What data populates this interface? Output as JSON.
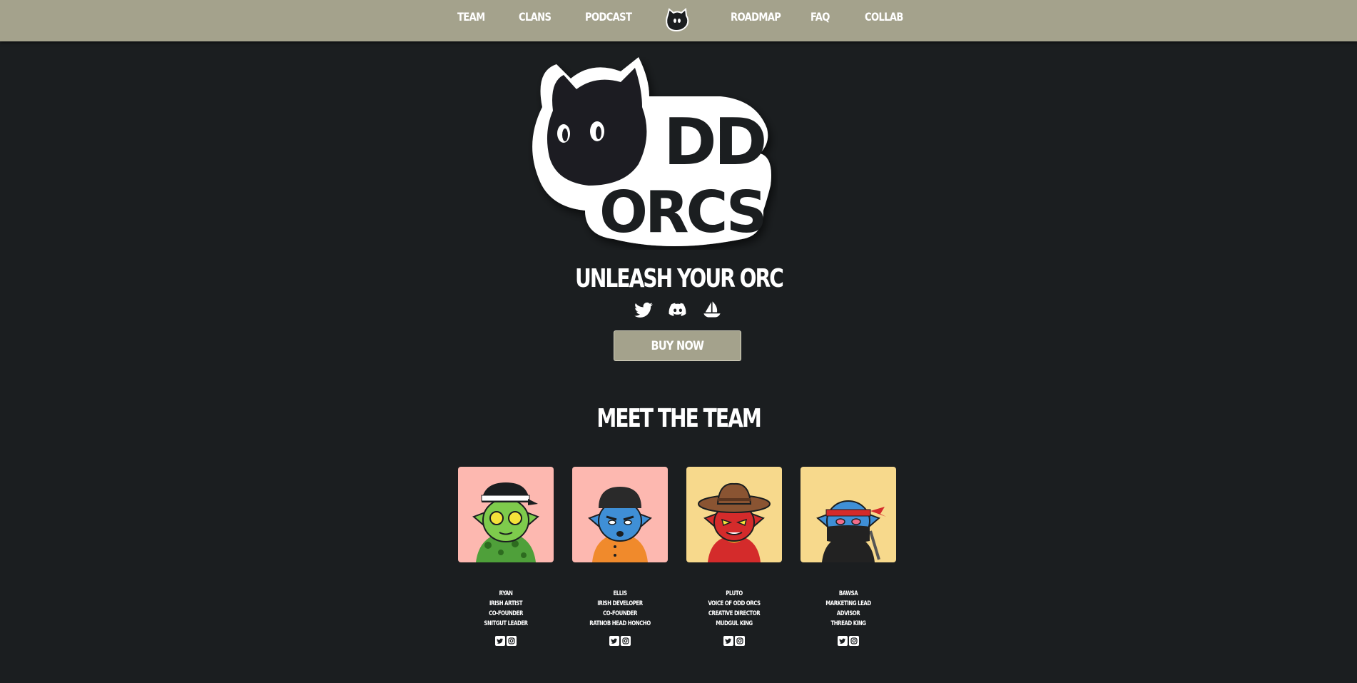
{
  "nav": {
    "left": [
      "TEAM",
      "CLANS",
      "PODCAST"
    ],
    "right": [
      "ROADMAP",
      "FAQ",
      "COLLAB"
    ],
    "logo_icon": "orc-head-icon"
  },
  "hero": {
    "logo_text_top": "DD",
    "logo_text_bottom": "ORCS",
    "tagline": "UNLEASH YOUR ORC",
    "social_icons": [
      "twitter-icon",
      "discord-icon",
      "opensea-icon"
    ],
    "buy_label": "BUY NOW"
  },
  "team": {
    "heading": "MEET THE TEAM",
    "members": [
      {
        "lines": [
          "RYAN",
          "IRISH ARTIST",
          "CO-FOUNDER",
          "SNITGUT LEADER"
        ],
        "bg": "#fdb8b0"
      },
      {
        "lines": [
          "ELLIS",
          "IRISH DEVELOPER",
          "CO-FOUNDER",
          "RATNOB HEAD HONCHO"
        ],
        "bg": "#fdb8b0"
      },
      {
        "lines": [
          "PLUTO",
          "VOICE OF ODD ORCS",
          "CREATIVE DIRECTOR",
          "MUDGUL KING"
        ],
        "bg": "#f7d98c"
      },
      {
        "lines": [
          "BAWSA",
          "MARKETING LEAD",
          "ADVISOR",
          "THREAD KING"
        ],
        "bg": "#f7d98c"
      }
    ]
  },
  "colors": {
    "background": "#1b1e20",
    "navbar": "#a4a28c",
    "text": "#ffffff"
  }
}
